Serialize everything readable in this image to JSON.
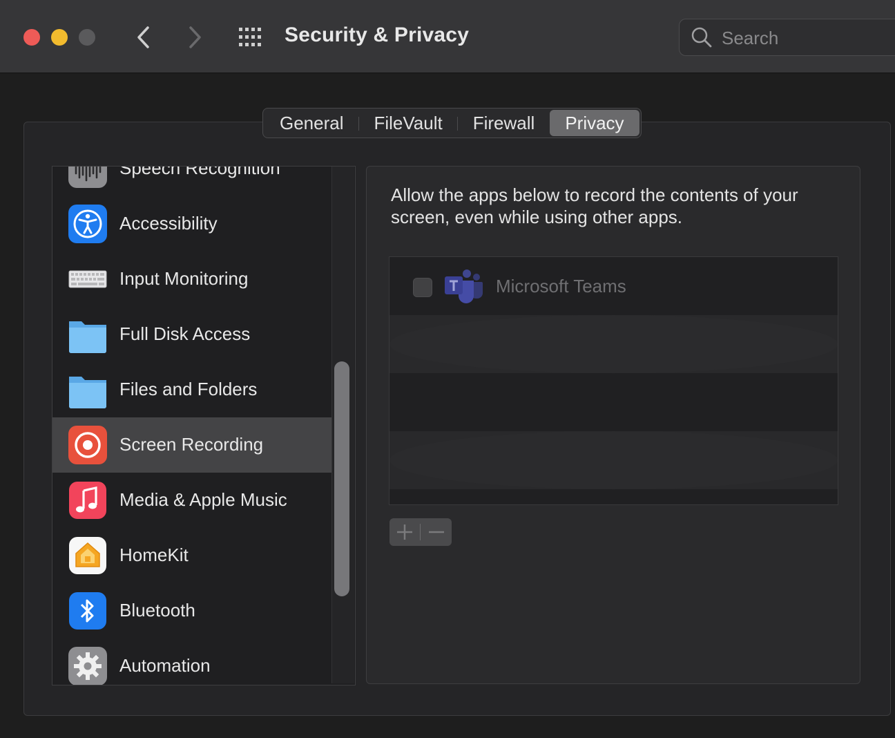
{
  "window": {
    "title": "Security & Privacy",
    "search_placeholder": "Search"
  },
  "tabs": [
    {
      "label": "General",
      "active": false
    },
    {
      "label": "FileVault",
      "active": false
    },
    {
      "label": "Firewall",
      "active": false
    },
    {
      "label": "Privacy",
      "active": true
    }
  ],
  "sidebar": {
    "items": [
      {
        "label": "Speech Recognition",
        "icon": "speech-recognition-icon",
        "selected": false
      },
      {
        "label": "Accessibility",
        "icon": "accessibility-icon",
        "selected": false
      },
      {
        "label": "Input Monitoring",
        "icon": "keyboard-icon",
        "selected": false
      },
      {
        "label": "Full Disk Access",
        "icon": "folder-icon",
        "selected": false
      },
      {
        "label": "Files and Folders",
        "icon": "folder-icon",
        "selected": false
      },
      {
        "label": "Screen Recording",
        "icon": "screen-recording-icon",
        "selected": true
      },
      {
        "label": "Media & Apple Music",
        "icon": "music-icon",
        "selected": false
      },
      {
        "label": "HomeKit",
        "icon": "homekit-icon",
        "selected": false
      },
      {
        "label": "Bluetooth",
        "icon": "bluetooth-icon",
        "selected": false
      },
      {
        "label": "Automation",
        "icon": "gear-icon",
        "selected": false
      }
    ]
  },
  "main": {
    "description": "Allow the apps below to record the contents of your screen, even while using other apps.",
    "apps": [
      {
        "name": "Microsoft Teams",
        "checked": false,
        "icon": "microsoft-teams-icon",
        "enabled": false
      }
    ],
    "add_label": "+",
    "remove_label": "–"
  },
  "colors": {
    "selected_row": "#444446",
    "red_light": "#ee5b57",
    "yellow_light": "#f2bb2e",
    "accessibility_blue": "#1f7cf0",
    "screen_recording_red": "#e8513c",
    "music_red": "#f2445b",
    "teams_purple": "#4b53bc"
  }
}
